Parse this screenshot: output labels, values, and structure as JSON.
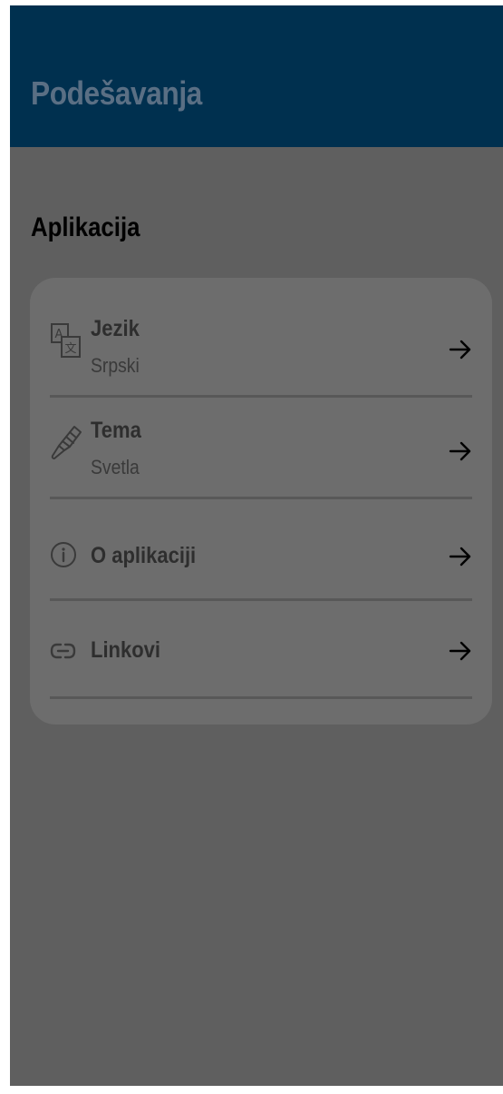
{
  "header": {
    "title": "Podešavanja"
  },
  "section": {
    "title": "Aplikacija"
  },
  "settings": {
    "items": [
      {
        "label": "Jezik",
        "value": "Srpski",
        "icon": "translate-icon"
      },
      {
        "label": "Tema",
        "value": "Svetla",
        "icon": "paintbrush-icon"
      },
      {
        "label": "O aplikaciji",
        "icon": "info-icon"
      },
      {
        "label": "Linkovi",
        "icon": "link-icon"
      }
    ]
  },
  "colors": {
    "app_bar": "#00304f",
    "background": "#5f5f5f",
    "card": "#6d6d6d"
  }
}
